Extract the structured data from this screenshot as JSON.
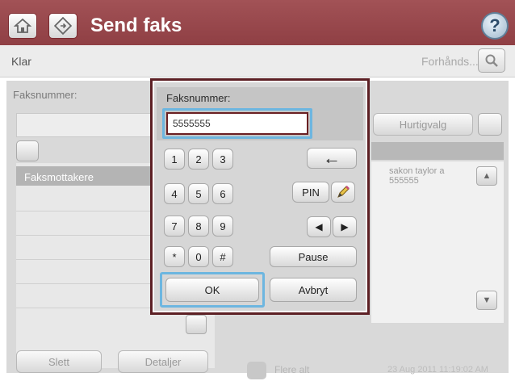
{
  "header": {
    "home_icon": "home-icon",
    "send_icon": "send-fax-icon",
    "title": "Send faks",
    "help_icon": "help-icon",
    "help_glyph": "?",
    "bar_color": "#9a484d"
  },
  "status": {
    "text": "Klar",
    "preview_label": "Forhånds...",
    "preview_icon": "magnifier-icon"
  },
  "background": {
    "fax_number_label": "Faksnummer:",
    "recipients_header": "Faksmottakere",
    "delete_button": "Slett",
    "details_button": "Detaljer",
    "speed_dial_button": "Hurtigvalg",
    "contact": "sakon taylor a 555555",
    "more_options": "Flere alt",
    "timestamp": "23 Aug 2011 11:19:02 AM"
  },
  "dialog": {
    "title": "Faksnummer:",
    "input_value": "5555555",
    "keys": [
      "1",
      "2",
      "3",
      "4",
      "5",
      "6",
      "7",
      "8",
      "9",
      "*",
      "0",
      "#"
    ],
    "backspace_glyph": "←",
    "pin_label": "PIN",
    "pause_label": "Pause",
    "left_arrow": "◀",
    "right_arrow": "▶",
    "ok_label": "OK",
    "cancel_label": "Avbryt",
    "highlight_color": "#6db6e0",
    "frame_color": "#5c1f24"
  }
}
